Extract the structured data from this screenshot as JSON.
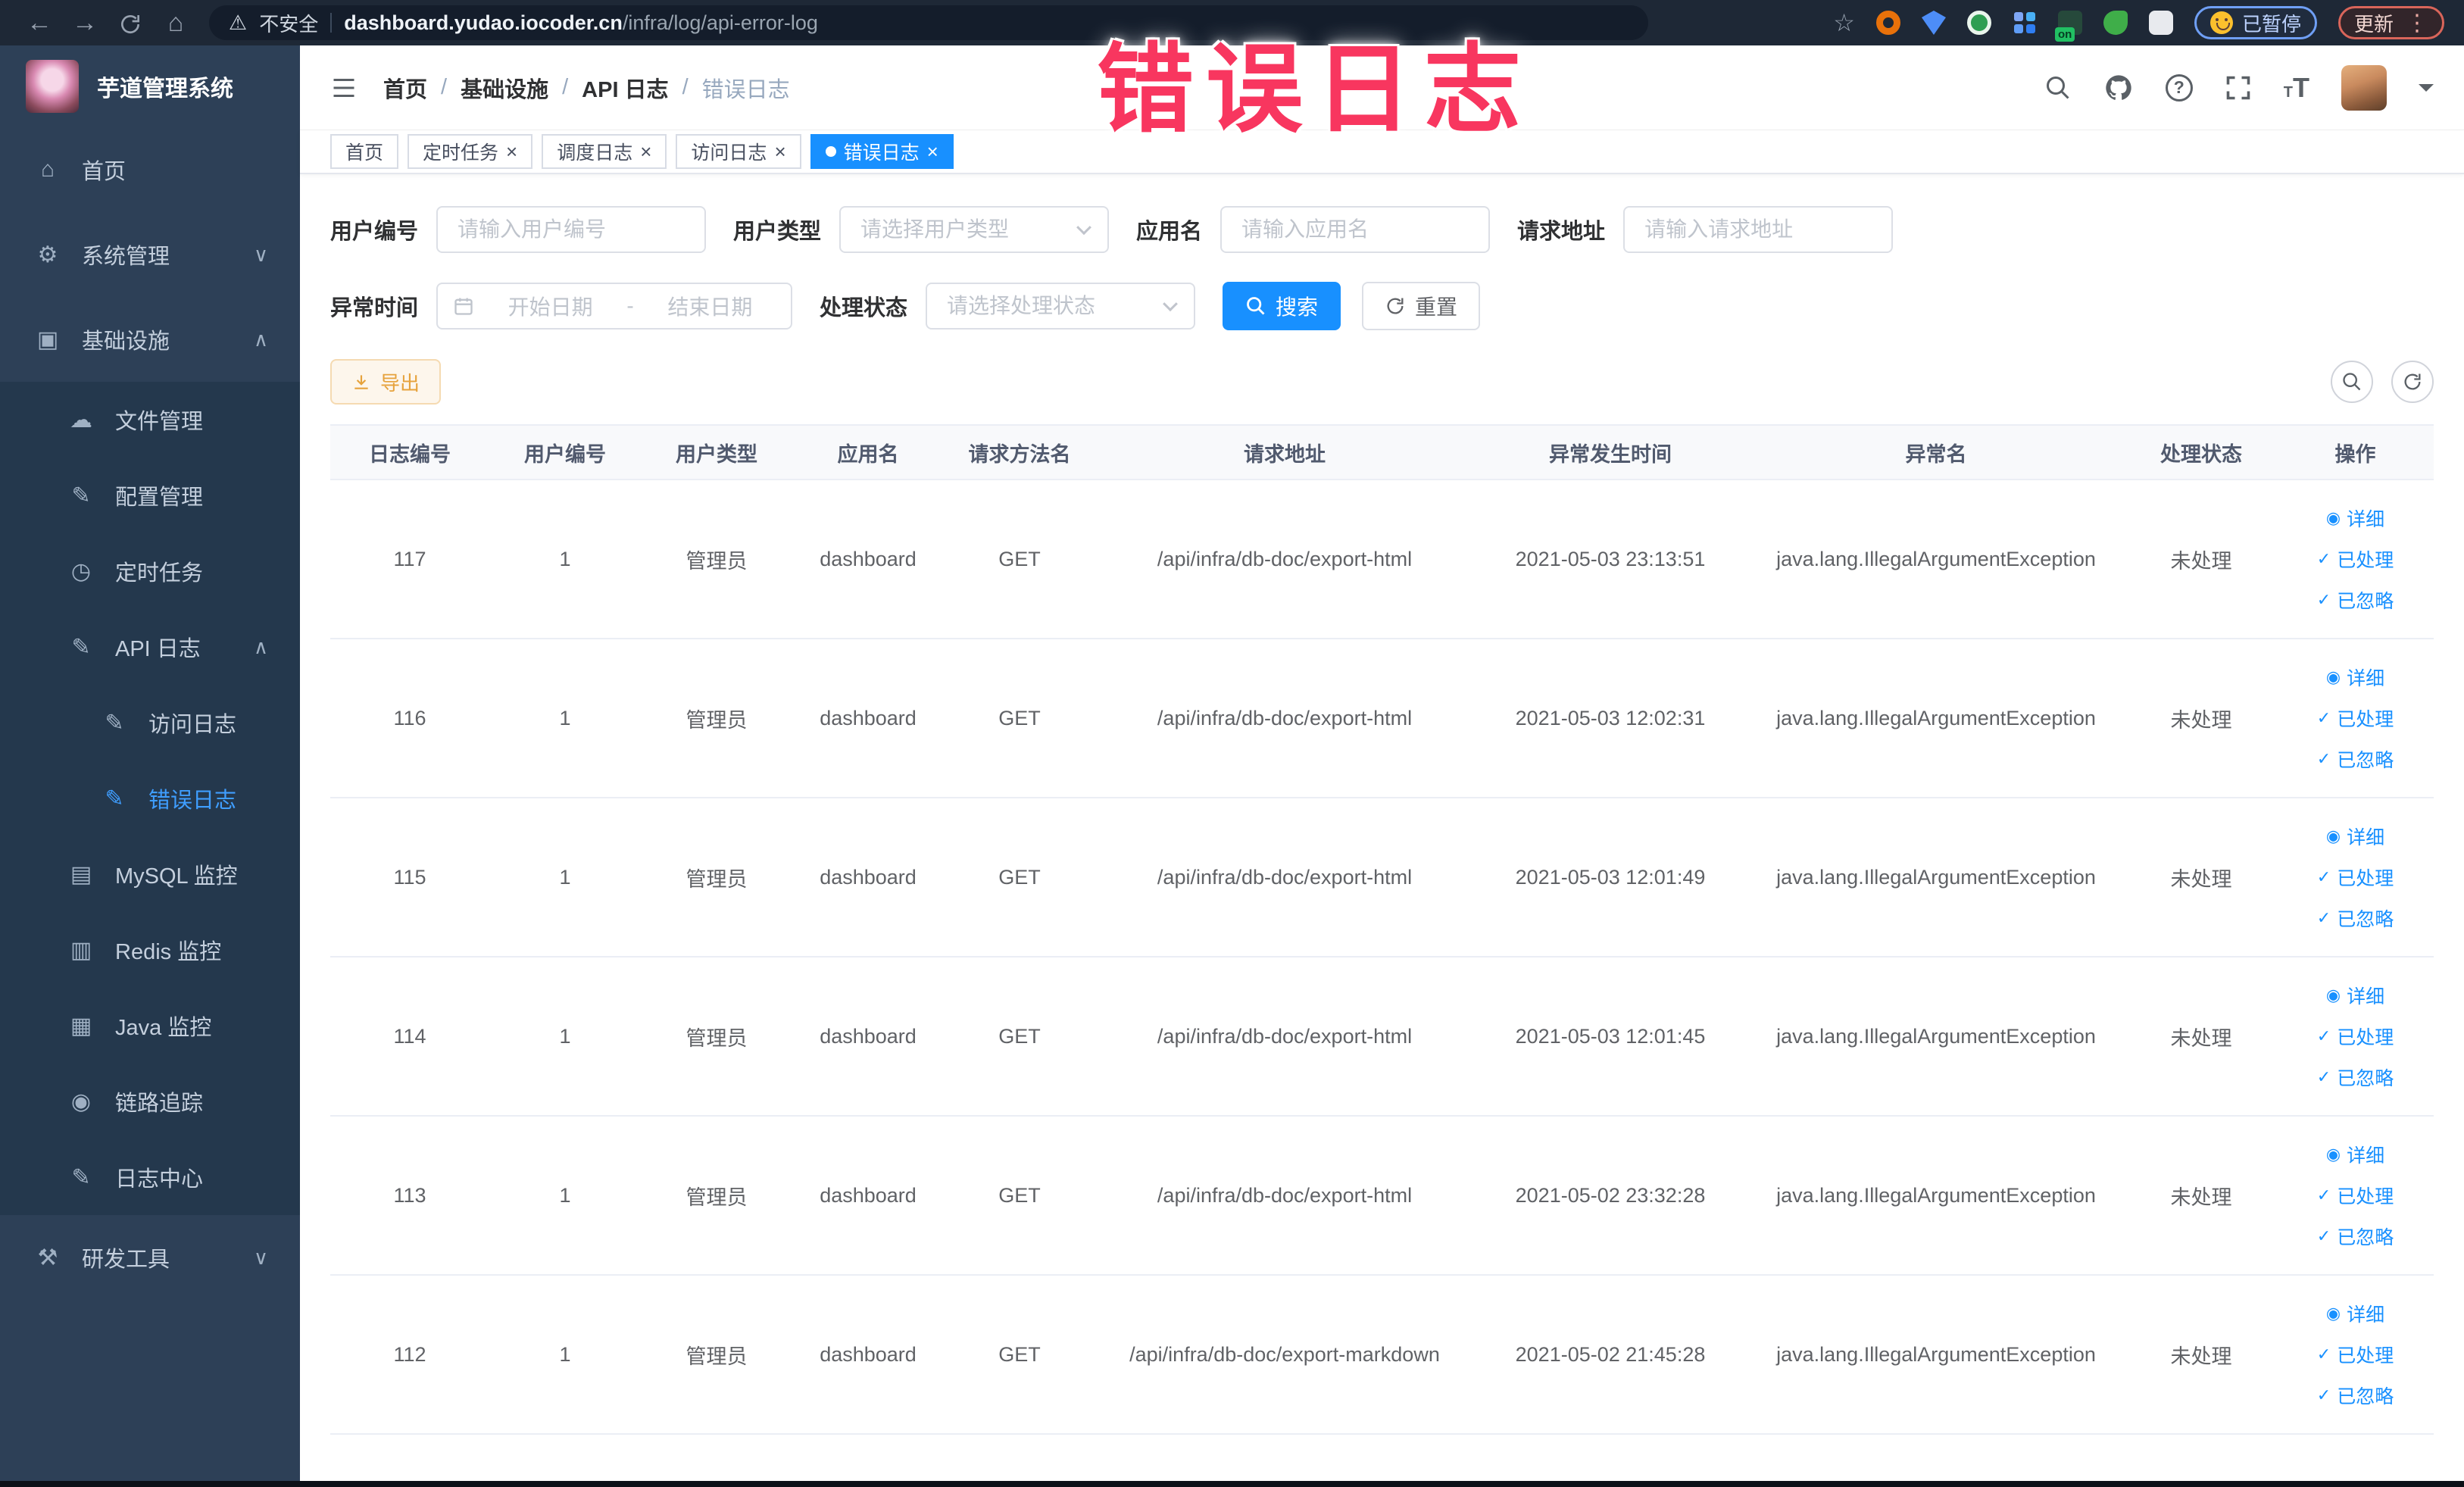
{
  "watermark_text": "错误日志",
  "browser": {
    "security_label": "不安全",
    "url_domain": "dashboard.yudao.iocoder.cn",
    "url_path": "/infra/log/api-error-log",
    "paused_badge_label": "已暂停",
    "update_button_label": "更新",
    "extension_on_badge": "on"
  },
  "sidebar": {
    "app_title": "芋道管理系统",
    "items": [
      {
        "key": "home",
        "label": "首页",
        "icon": "home",
        "level": 1
      },
      {
        "key": "system",
        "label": "系统管理",
        "icon": "gear",
        "level": 1,
        "arrow": "down"
      },
      {
        "key": "infra",
        "label": "基础设施",
        "icon": "infra",
        "level": 1,
        "arrow": "up"
      },
      {
        "key": "file",
        "label": "文件管理",
        "icon": "upload",
        "level": 2
      },
      {
        "key": "config",
        "label": "配置管理",
        "icon": "edit",
        "level": 2
      },
      {
        "key": "job",
        "label": "定时任务",
        "icon": "clock",
        "level": 2
      },
      {
        "key": "api-log",
        "label": "API 日志",
        "icon": "log",
        "level": 2,
        "arrow": "up"
      },
      {
        "key": "api-access-log",
        "label": "访问日志",
        "icon": "log",
        "level": 3
      },
      {
        "key": "api-error-log",
        "label": "错误日志",
        "icon": "log",
        "level": 3,
        "active": true
      },
      {
        "key": "mysql",
        "label": "MySQL 监控",
        "icon": "mysql",
        "level": 2
      },
      {
        "key": "redis",
        "label": "Redis 监控",
        "icon": "redis",
        "level": 2
      },
      {
        "key": "java",
        "label": "Java 监控",
        "icon": "java",
        "level": 2
      },
      {
        "key": "tracer",
        "label": "链路追踪",
        "icon": "eye",
        "level": 2
      },
      {
        "key": "log-center",
        "label": "日志中心",
        "icon": "log",
        "level": 2
      },
      {
        "key": "dev-tools",
        "label": "研发工具",
        "icon": "tool",
        "level": 1,
        "arrow": "down"
      }
    ]
  },
  "breadcrumb": [
    "首页",
    "基础设施",
    "API 日志",
    "错误日志"
  ],
  "tabs": [
    {
      "key": "home",
      "label": "首页",
      "closable": false,
      "active": false
    },
    {
      "key": "job",
      "label": "定时任务",
      "closable": true,
      "active": false
    },
    {
      "key": "job-log",
      "label": "调度日志",
      "closable": true,
      "active": false
    },
    {
      "key": "api-access-log",
      "label": "访问日志",
      "closable": true,
      "active": false
    },
    {
      "key": "api-error-log",
      "label": "错误日志",
      "closable": true,
      "active": true
    }
  ],
  "filters": {
    "user_id": {
      "label": "用户编号",
      "placeholder": "请输入用户编号"
    },
    "user_type": {
      "label": "用户类型",
      "placeholder": "请选择用户类型"
    },
    "app_name": {
      "label": "应用名",
      "placeholder": "请输入应用名"
    },
    "request_url": {
      "label": "请求地址",
      "placeholder": "请输入请求地址"
    },
    "exception_time": {
      "label": "异常时间",
      "start_placeholder": "开始日期",
      "separator": "-",
      "end_placeholder": "结束日期"
    },
    "process_status": {
      "label": "处理状态",
      "placeholder": "请选择处理状态"
    },
    "search_label": "搜索",
    "reset_label": "重置"
  },
  "toolbar": {
    "export_label": "导出"
  },
  "table": {
    "headers": [
      "日志编号",
      "用户编号",
      "用户类型",
      "应用名",
      "请求方法名",
      "请求地址",
      "异常发生时间",
      "异常名",
      "处理状态",
      "操作"
    ],
    "actions": [
      "详细",
      "已处理",
      "已忽略"
    ],
    "rows": [
      {
        "id": "117",
        "user_id": "1",
        "user_type": "管理员",
        "app": "dashboard",
        "method": "GET",
        "url": "/api/infra/db-doc/export-html",
        "time": "2021-05-03 23:13:51",
        "exception": "java.lang.IllegalArgumentException",
        "status": "未处理"
      },
      {
        "id": "116",
        "user_id": "1",
        "user_type": "管理员",
        "app": "dashboard",
        "method": "GET",
        "url": "/api/infra/db-doc/export-html",
        "time": "2021-05-03 12:02:31",
        "exception": "java.lang.IllegalArgumentException",
        "status": "未处理"
      },
      {
        "id": "115",
        "user_id": "1",
        "user_type": "管理员",
        "app": "dashboard",
        "method": "GET",
        "url": "/api/infra/db-doc/export-html",
        "time": "2021-05-03 12:01:49",
        "exception": "java.lang.IllegalArgumentException",
        "status": "未处理"
      },
      {
        "id": "114",
        "user_id": "1",
        "user_type": "管理员",
        "app": "dashboard",
        "method": "GET",
        "url": "/api/infra/db-doc/export-html",
        "time": "2021-05-03 12:01:45",
        "exception": "java.lang.IllegalArgumentException",
        "status": "未处理"
      },
      {
        "id": "113",
        "user_id": "1",
        "user_type": "管理员",
        "app": "dashboard",
        "method": "GET",
        "url": "/api/infra/db-doc/export-html",
        "time": "2021-05-02 23:32:28",
        "exception": "java.lang.IllegalArgumentException",
        "status": "未处理"
      },
      {
        "id": "112",
        "user_id": "1",
        "user_type": "管理员",
        "app": "dashboard",
        "method": "GET",
        "url": "/api/infra/db-doc/export-markdown",
        "time": "2021-05-02 21:45:28",
        "exception": "java.lang.IllegalArgumentException",
        "status": "未处理"
      }
    ]
  },
  "colors": {
    "accent": "#1890ff",
    "sidebar_bg": "#2d4057",
    "submenu_bg": "#24384d",
    "warning": "#e6a23c",
    "watermark": "#f8365f",
    "active_link": "#3f9eff"
  }
}
